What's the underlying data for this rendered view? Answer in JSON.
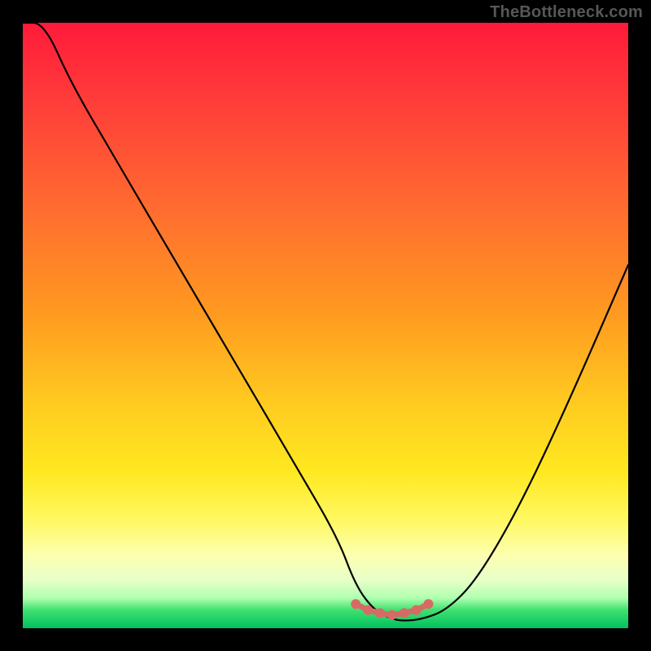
{
  "watermark": "TheBottleneck.com",
  "chart_data": {
    "type": "line",
    "title": "",
    "xlabel": "",
    "ylabel": "",
    "xlim": [
      0,
      100
    ],
    "ylim": [
      0,
      100
    ],
    "grid": false,
    "series": [
      {
        "name": "bottleneck-curve",
        "x": [
          0,
          3.5,
          8,
          15,
          25,
          35,
          45,
          52,
          55,
          58,
          61,
          63,
          66,
          70,
          75,
          82,
          90,
          100
        ],
        "values": [
          100,
          100,
          90,
          78,
          61,
          44,
          27,
          15,
          7,
          3,
          1.5,
          1.2,
          1.5,
          3,
          8,
          20,
          37,
          60
        ]
      }
    ],
    "markers": {
      "name": "bottom-markers",
      "x": [
        55,
        57,
        59,
        61,
        63,
        65,
        67
      ],
      "values": [
        4,
        3,
        2.5,
        2.2,
        2.5,
        3,
        4
      ]
    },
    "gradient_stops": [
      "#ff1a3a",
      "#ff3a3a",
      "#ff6a30",
      "#ff9a20",
      "#ffc820",
      "#ffe820",
      "#fff860",
      "#fcffb0",
      "#e8ffc8",
      "#b0ffb0",
      "#40e070",
      "#00c060"
    ]
  }
}
